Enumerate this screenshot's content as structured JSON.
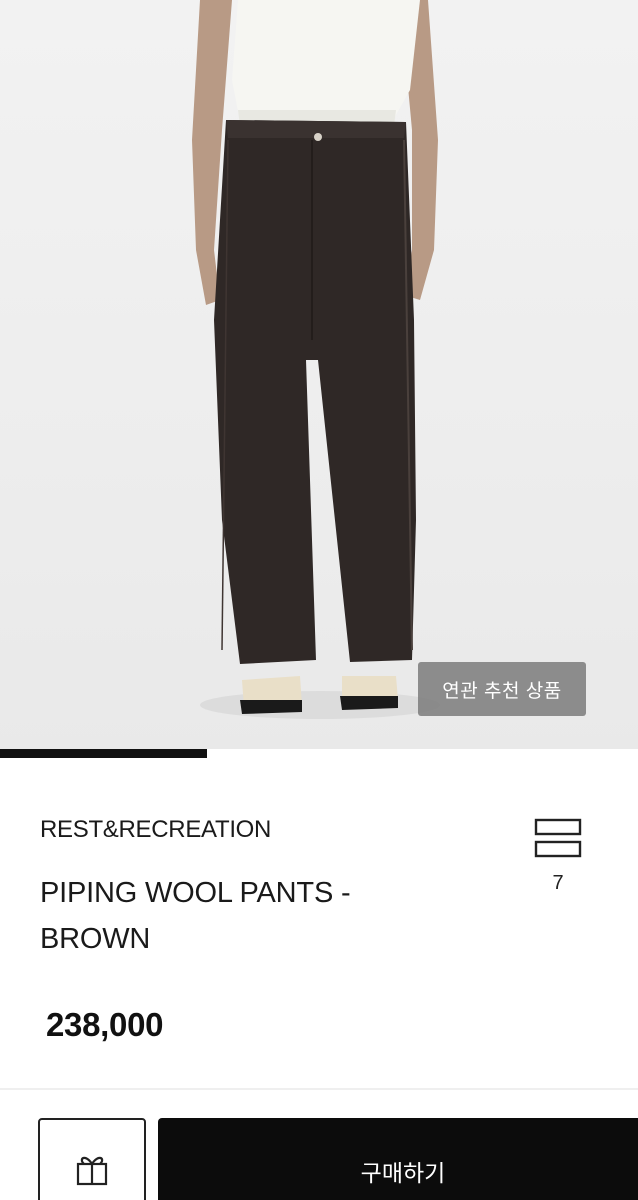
{
  "hero": {
    "image_alt": "",
    "recommend_badge": "연관 추천 상품",
    "progress_fraction": 0.325
  },
  "product": {
    "brand": "REST&RECREATION",
    "title": "PIPING WOOL PANTS - BROWN",
    "price": "238,000"
  },
  "wishlist": {
    "icon": "wishlist-layers-icon",
    "count": "7"
  },
  "bottom_bar": {
    "gift_icon": "gift-icon",
    "buy_label": "구매하기"
  },
  "colors": {
    "primary": "#0c0c0c",
    "badge_bg": "#787878",
    "pants": "#2f2826"
  }
}
